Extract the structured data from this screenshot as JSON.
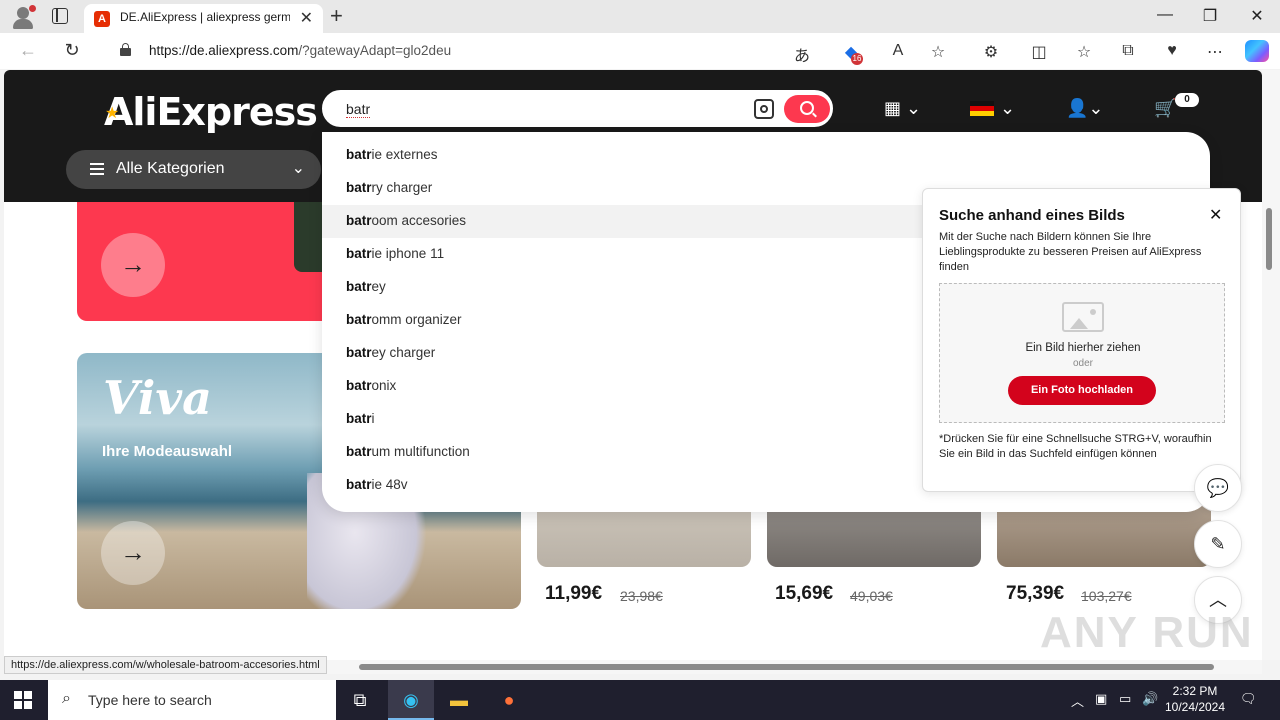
{
  "browser": {
    "tab_title": "DE.AliExpress | aliexpress german",
    "tab_favicon": "aliexpress-favicon",
    "url_host": "https://de.aliexpress.com",
    "url_path": "/?gatewayAdapt=glo2deu",
    "extension_badge": "16",
    "status_url": "https://de.aliexpress.com/w/wholesale-batroom-accesories.html"
  },
  "header": {
    "logo": "AliExpress",
    "search_query": "batr",
    "cart_count": "0",
    "all_categories": "Alle Kategorien"
  },
  "suggestions": [
    {
      "match": "batr",
      "rest": "ie externes"
    },
    {
      "match": "batr",
      "rest": "ry charger"
    },
    {
      "match": "batr",
      "rest": "oom accesories"
    },
    {
      "match": "batr",
      "rest": "ie iphone 11"
    },
    {
      "match": "batr",
      "rest": "ey"
    },
    {
      "match": "batr",
      "rest": "omm organizer"
    },
    {
      "match": "batr",
      "rest": "ey charger"
    },
    {
      "match": "batr",
      "rest": "onix"
    },
    {
      "match": "batr",
      "rest": "i"
    },
    {
      "match": "batr",
      "rest": "um multifunction"
    },
    {
      "match": "batr",
      "rest": "ie 48v"
    }
  ],
  "image_search": {
    "title": "Suche anhand eines Bilds",
    "description": "Mit der Suche nach Bildern können Sie Ihre Lieblingsprodukte zu besseren Preisen auf AliExpress finden",
    "drag_text": "Ein Bild hierher ziehen",
    "or_text": "oder",
    "upload_button": "Ein Foto hochladen",
    "hint": "*Drücken Sie für eine Schnellsuche STRG+V, woraufhin Sie ein Bild in das Suchfeld einfügen können"
  },
  "content": {
    "viva_title": "Viva",
    "viva_subtitle": "Ihre Modeauswahl",
    "products": [
      {
        "price": "11,99€",
        "old_price": "23,98€"
      },
      {
        "price": "15,69€",
        "old_price": "49,03€"
      },
      {
        "price": "75,39€",
        "old_price": "103,27€"
      }
    ]
  },
  "watermark": "ANY RUN",
  "taskbar": {
    "search_placeholder": "Type here to search",
    "time": "2:32 PM",
    "date": "10/24/2024"
  },
  "colors": {
    "brand_red": "#fd384f",
    "header_bg": "#191919",
    "upload_red": "#d3031c"
  }
}
